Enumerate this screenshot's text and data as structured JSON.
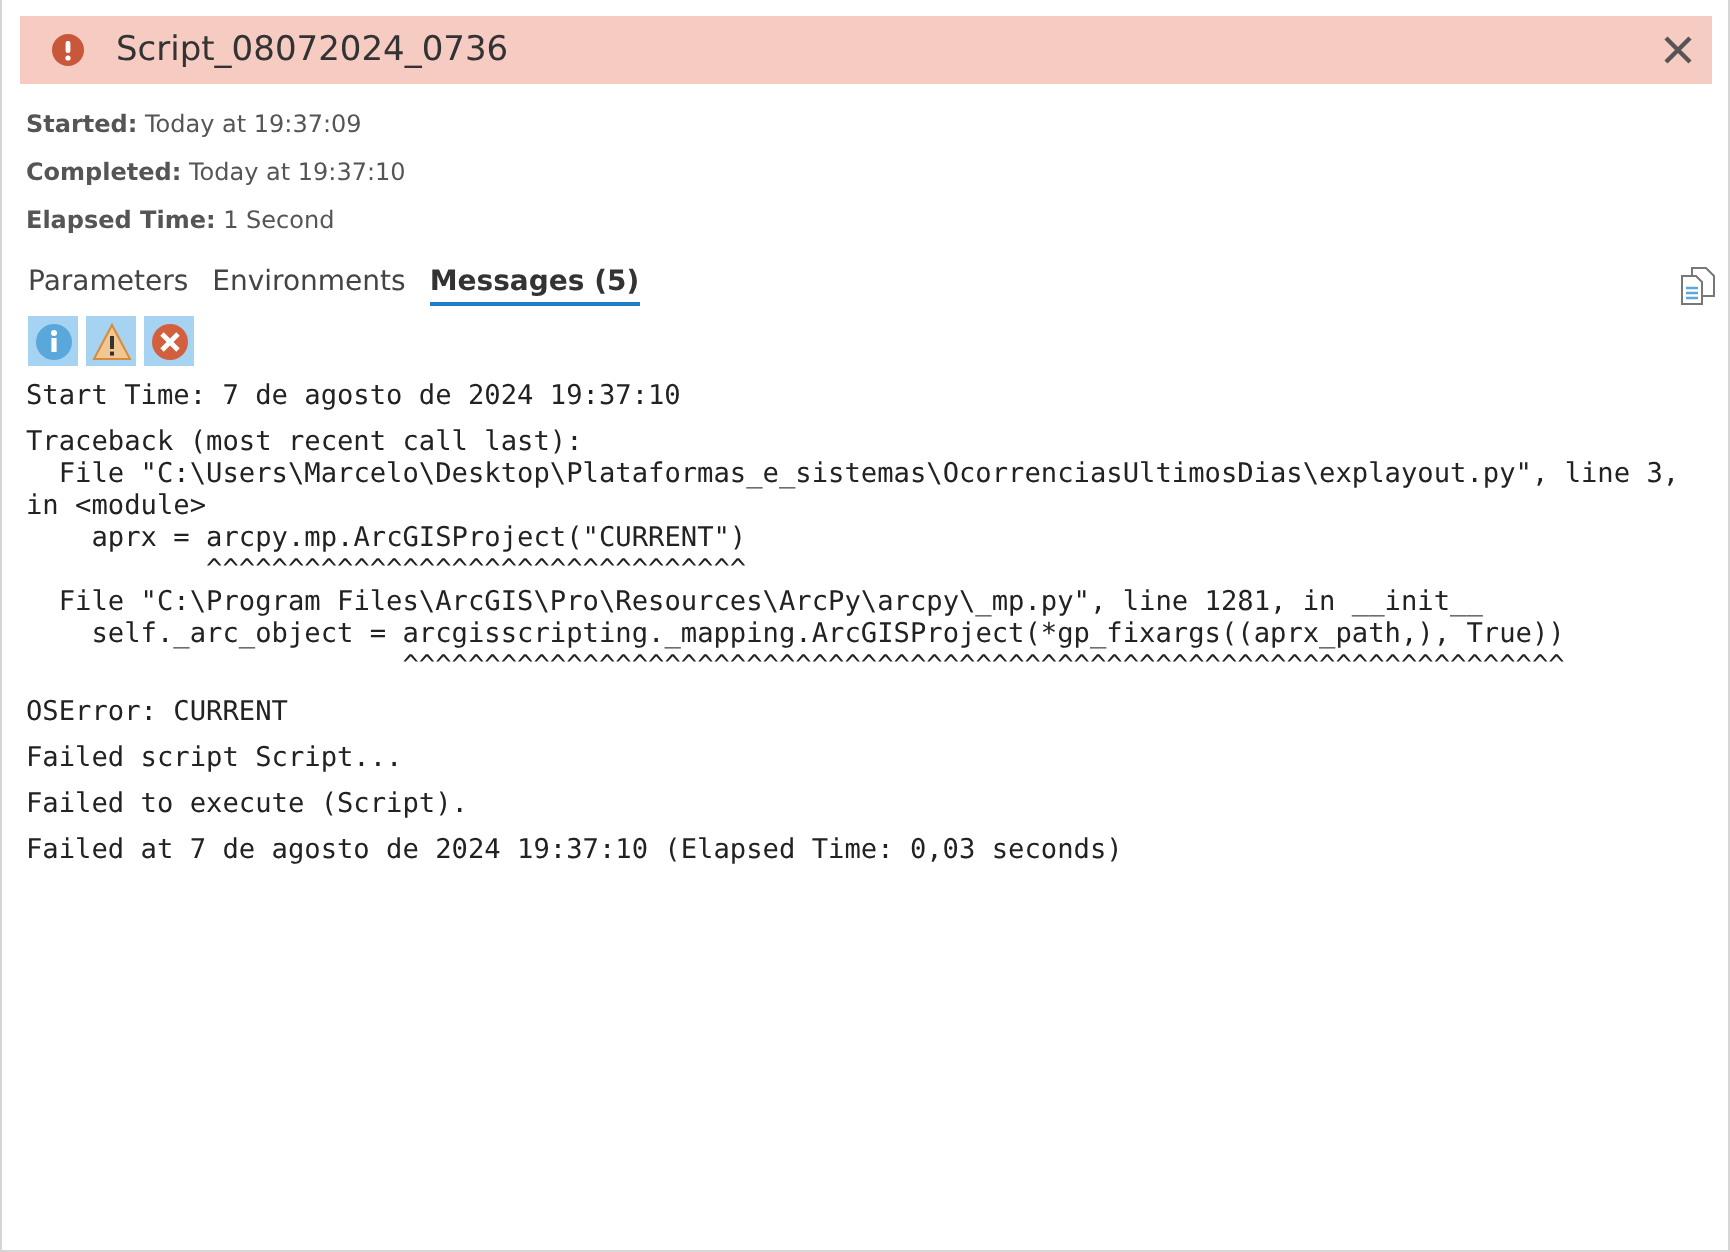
{
  "header": {
    "title": "Script_08072024_0736",
    "failed": true
  },
  "details": [
    "**Started:** Today at 19:37:09",
    "**Completed:** Today at 19:37:10",
    "**Elapsed Time:** 1 Second"
  ],
  "tabs": [
    {
      "label": "Parameters",
      "selected": false
    },
    {
      "label": "Environments",
      "selected": false
    },
    {
      "label": "Messages (5)",
      "selected": true
    }
  ],
  "filters": [
    {
      "kind": "info",
      "selected": true
    },
    {
      "kind": "warning",
      "selected": true
    },
    {
      "kind": "error",
      "selected": true
    }
  ],
  "messages": [
    "Start Time: 7 de agosto de 2024 19:37:10",
    "Traceback (most recent call last):\n  File \"C:\\Users\\Marcelo\\Desktop\\Plataformas_e_sistemas\\OcorrenciasUltimosDias\\explayout.py\", line 3, in <module>\n    aprx = arcpy.mp.ArcGISProject(\"CURRENT\")\n           ^^^^^^^^^^^^^^^^^^^^^^^^^^^^^^^^^\n  File \"C:\\Program Files\\ArcGIS\\Pro\\Resources\\ArcPy\\arcpy\\_mp.py\", line 1281, in __init__\n    self._arc_object = arcgisscripting._mapping.ArcGISProject(*gp_fixargs((aprx_path,), True))\n                       ^^^^^^^^^^^^^^^^^^^^^^^^^^^^^^^^^^^^^^^^^^^^^^^^^^^^^^^^^^^^^^^^^^^^^^^",
    "OSError: CURRENT",
    "Failed script Script...",
    "Failed to execute (Script).",
    "Failed at 7 de agosto de 2024 19:37:10 (Elapsed Time: 0,03 seconds)"
  ]
}
